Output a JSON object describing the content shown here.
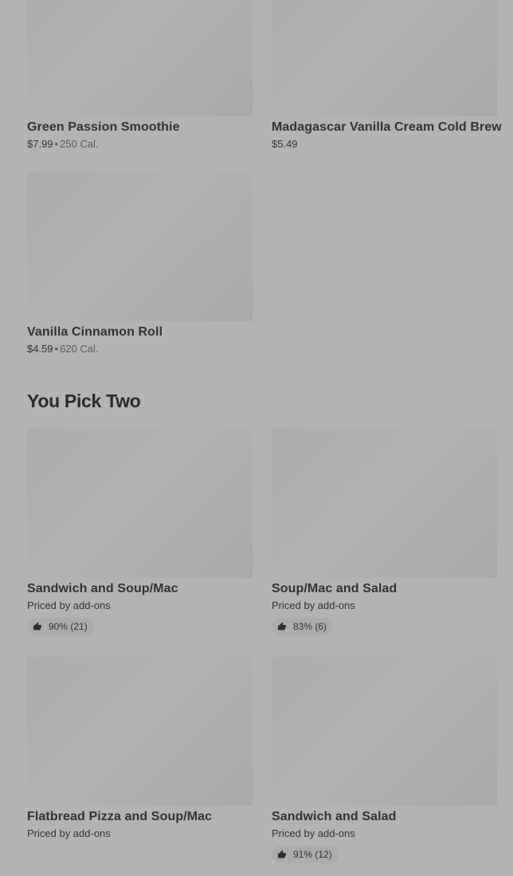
{
  "menu_items": [
    {
      "name": "Green Passion Smoothie",
      "price": "$7.99",
      "calories": "250 Cal."
    },
    {
      "name": "Madagascar Vanilla Cream Cold Brew",
      "price": "$5.49"
    },
    {
      "name": "Vanilla Cinnamon Roll",
      "price": "$4.59",
      "calories": "620 Cal."
    }
  ],
  "you_pick_two": {
    "title": "You Pick Two",
    "items": [
      {
        "name": "Sandwich and Soup/Mac",
        "price": "Priced by add-ons",
        "rating": "90% (21)"
      },
      {
        "name": "Soup/Mac and Salad",
        "price": "Priced by add-ons",
        "rating": "83% (6)"
      },
      {
        "name": "Flatbread Pizza and Soup/Mac",
        "price": "Priced by add-ons"
      },
      {
        "name": "Sandwich and Salad",
        "price": "Priced by add-ons",
        "rating": "91% (12)"
      }
    ]
  },
  "icons": {
    "rating": "thumbs-up-icon",
    "separator": "bullet-dot"
  }
}
